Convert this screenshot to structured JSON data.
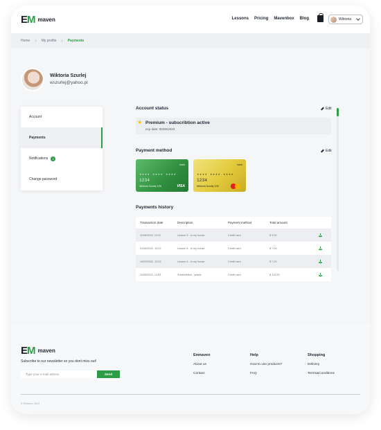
{
  "header": {
    "logo_mark": "EM",
    "logo_word": "maven",
    "nav": [
      "Lessons",
      "Pricing",
      "Mavenbox",
      "Blog"
    ],
    "user_name": "Wiktoria"
  },
  "breadcrumb": [
    "Home",
    "My profile",
    "Payments"
  ],
  "profile": {
    "name": "Wiktoria Szurlej",
    "email": "wszurlej@yahoo.pl"
  },
  "sidebar": {
    "items": [
      {
        "label": "Account"
      },
      {
        "label": "Payments",
        "active": true
      },
      {
        "label": "Notifications",
        "badge": "2"
      },
      {
        "label": "Change password"
      }
    ]
  },
  "account_status": {
    "title": "Account status",
    "edit": "Edit",
    "plan": "Premium - subscribtion active",
    "exp": "exp date: 05/06/2023"
  },
  "payment_method": {
    "title": "Payment method",
    "edit": "Edit",
    "cards": [
      {
        "label": "bank",
        "number": "**** **** **** 1234",
        "holder": "Wiktoria Szurlej   1/30",
        "brand": "VISA"
      },
      {
        "label": "bank",
        "number": "**** **** **** 1234",
        "holder": "Wiktoria Szurlej   1/30",
        "brand": "mastercard"
      }
    ]
  },
  "history": {
    "title": "Payments history",
    "columns": [
      "Transaction date",
      "Description",
      "Payment method",
      "Total amount"
    ],
    "rows": [
      [
        "11/06/2022, 13:22",
        "Lesson 3 - In my house",
        "Credit card",
        "$ 3,00"
      ],
      [
        "01/06/2022, 13:22",
        "Lesson 5 - In my house",
        "Credit card",
        "$ 7,00"
      ],
      [
        "14/05/2022, 13:22",
        "Lesson 4 - In my house",
        "Credit card",
        "$ 7,00"
      ],
      [
        "11/05/2022, 14:53",
        "Subscribtion - yearly",
        "Credit card",
        "$ 112,00"
      ]
    ]
  },
  "footer": {
    "newsletter_text": "Subscribe to our newsletter so you dont miss out!",
    "email_placeholder": "Type your e-mail adress",
    "send_label": "Send",
    "columns": [
      {
        "title": "Enmaven",
        "links": [
          "About us",
          "Contact"
        ]
      },
      {
        "title": "Help",
        "links": [
          "How to use products?",
          "FAQ"
        ]
      },
      {
        "title": "Shopping",
        "links": [
          "Delivery",
          "Terms&Conditions"
        ]
      }
    ],
    "copyright": "© EMaven 2022"
  },
  "colors": {
    "accent": "#2e9b46",
    "background": "#f5f6f8"
  },
  "icons": [
    "bag-icon",
    "chevron-down-icon",
    "pencil-icon",
    "star-icon",
    "download-icon"
  ]
}
